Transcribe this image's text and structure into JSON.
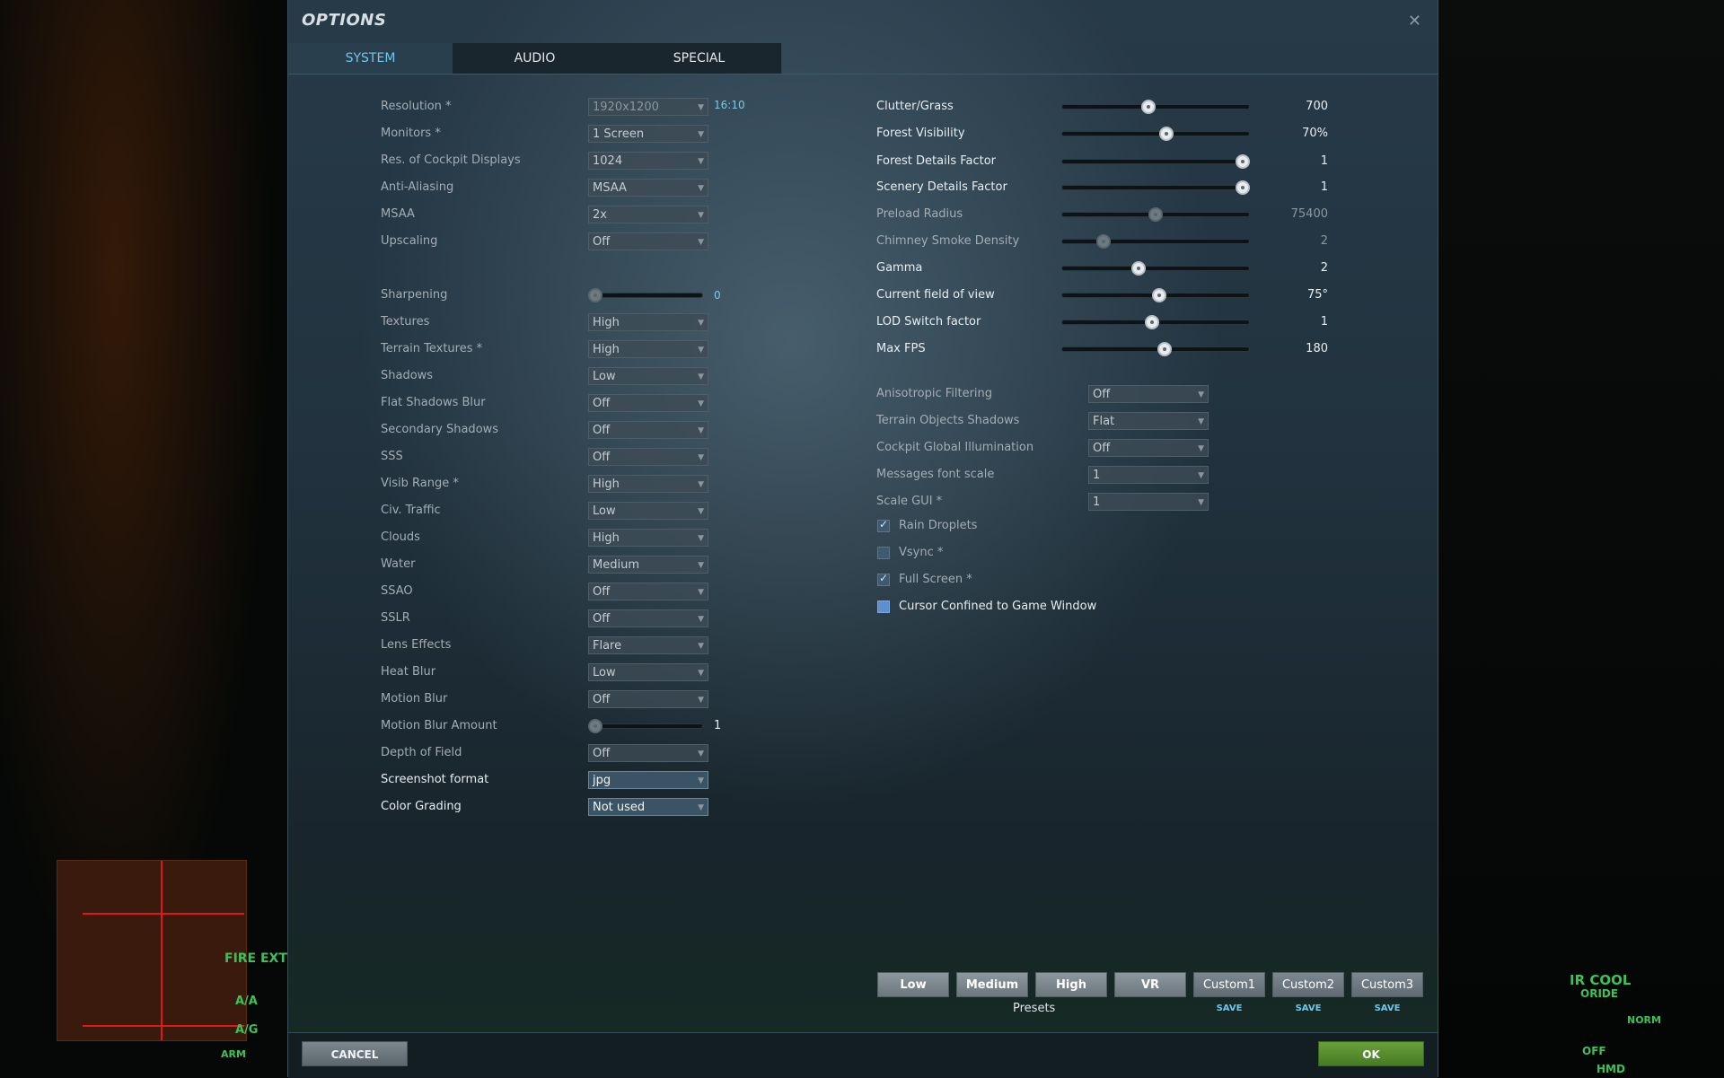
{
  "dialog": {
    "title": "OPTIONS",
    "close_glyph": "✕"
  },
  "tabs": [
    {
      "label": "SYSTEM",
      "active": true
    },
    {
      "label": "AUDIO",
      "active": false
    },
    {
      "label": "SPECIAL",
      "active": false
    }
  ],
  "left_dropdowns_top": [
    {
      "label": "Resolution *",
      "value": "1920x1200",
      "extra": "16:10"
    },
    {
      "label": "Monitors *",
      "value": "1 Screen"
    },
    {
      "label": "Res. of Cockpit Displays",
      "value": "1024"
    },
    {
      "label": "Anti-Aliasing",
      "value": "MSAA"
    },
    {
      "label": "MSAA",
      "value": "2x"
    },
    {
      "label": "Upscaling",
      "value": "Off"
    }
  ],
  "sharpening": {
    "label": "Sharpening",
    "value": "0",
    "fraction": 0.0
  },
  "left_dropdowns_mid": [
    {
      "label": "Textures",
      "value": "High"
    },
    {
      "label": "Terrain Textures *",
      "value": "High"
    },
    {
      "label": "Shadows",
      "value": "Low"
    },
    {
      "label": "Flat Shadows Blur",
      "value": "Off"
    },
    {
      "label": "Secondary Shadows",
      "value": "Off"
    },
    {
      "label": "SSS",
      "value": "Off"
    },
    {
      "label": "Visib Range *",
      "value": "High"
    },
    {
      "label": "Civ. Traffic",
      "value": "Low"
    },
    {
      "label": "Clouds",
      "value": "High"
    },
    {
      "label": "Water",
      "value": "Medium"
    },
    {
      "label": "SSAO",
      "value": "Off"
    },
    {
      "label": "SSLR",
      "value": "Off"
    },
    {
      "label": "Lens Effects",
      "value": "Flare"
    },
    {
      "label": "Heat Blur",
      "value": "Low"
    },
    {
      "label": "Motion Blur",
      "value": "Off"
    }
  ],
  "motion_blur_amount": {
    "label": "Motion Blur Amount",
    "value": "1",
    "fraction": 0.0
  },
  "left_dropdowns_bottom": [
    {
      "label": "Depth of Field",
      "value": "Off"
    },
    {
      "label": "Screenshot format",
      "value": "jpg"
    },
    {
      "label": "Color Grading",
      "value": "Not used"
    }
  ],
  "right_sliders": [
    {
      "label": "Clutter/Grass",
      "value": "700",
      "fraction": 0.46,
      "enabled": true
    },
    {
      "label": "Forest Visibility",
      "value": "70%",
      "fraction": 0.56,
      "enabled": true
    },
    {
      "label": "Forest Details Factor",
      "value": "1",
      "fraction": 1.0,
      "enabled": true
    },
    {
      "label": "Scenery Details Factor",
      "value": "1",
      "fraction": 1.0,
      "enabled": true
    },
    {
      "label": "Preload Radius",
      "value": "75400",
      "fraction": 0.5,
      "enabled": false
    },
    {
      "label": "Chimney Smoke Density",
      "value": "2",
      "fraction": 0.2,
      "enabled": false
    },
    {
      "label": "Gamma",
      "value": "2",
      "fraction": 0.4,
      "enabled": true
    },
    {
      "label": "Current field of view",
      "value": "75°",
      "fraction": 0.52,
      "enabled": true
    },
    {
      "label": "LOD Switch factor",
      "value": "1",
      "fraction": 0.48,
      "enabled": true
    },
    {
      "label": "Max FPS",
      "value": "180",
      "fraction": 0.55,
      "enabled": true
    }
  ],
  "right_dropdowns": [
    {
      "label": "Anisotropic Filtering",
      "value": "Off"
    },
    {
      "label": "Terrain Objects Shadows",
      "value": "Flat"
    },
    {
      "label": "Cockpit Global Illumination",
      "value": "Off"
    },
    {
      "label": "Messages font scale",
      "value": "1"
    },
    {
      "label": "Scale GUI *",
      "value": "1"
    }
  ],
  "checkboxes": [
    {
      "label": "Rain Droplets",
      "checked": true
    },
    {
      "label": "Vsync *",
      "checked": false
    },
    {
      "label": "Full Screen *",
      "checked": true
    },
    {
      "label": "Cursor Confined to Game Window",
      "checked": false
    }
  ],
  "presets": {
    "label": "Presets",
    "buttons": [
      "Low",
      "Medium",
      "High",
      "VR",
      "Custom1",
      "Custom2",
      "Custom3"
    ],
    "save_label": "SAVE"
  },
  "footer": {
    "cancel_label": "CANCEL",
    "ok_label": "OK"
  },
  "background_hud": {
    "fire_extgh": "FIRE EXTGH",
    "aa": "A/A",
    "ag": "A/G",
    "arm": "ARM",
    "ir_cool": "IR COOL",
    "oride": "ORIDE",
    "norm": "NORM",
    "off": "OFF",
    "hmd": "HMD"
  },
  "colors": {
    "accent": "#6fc7ef",
    "ok_green": "#5a9330",
    "hud_green": "#3cc257"
  }
}
